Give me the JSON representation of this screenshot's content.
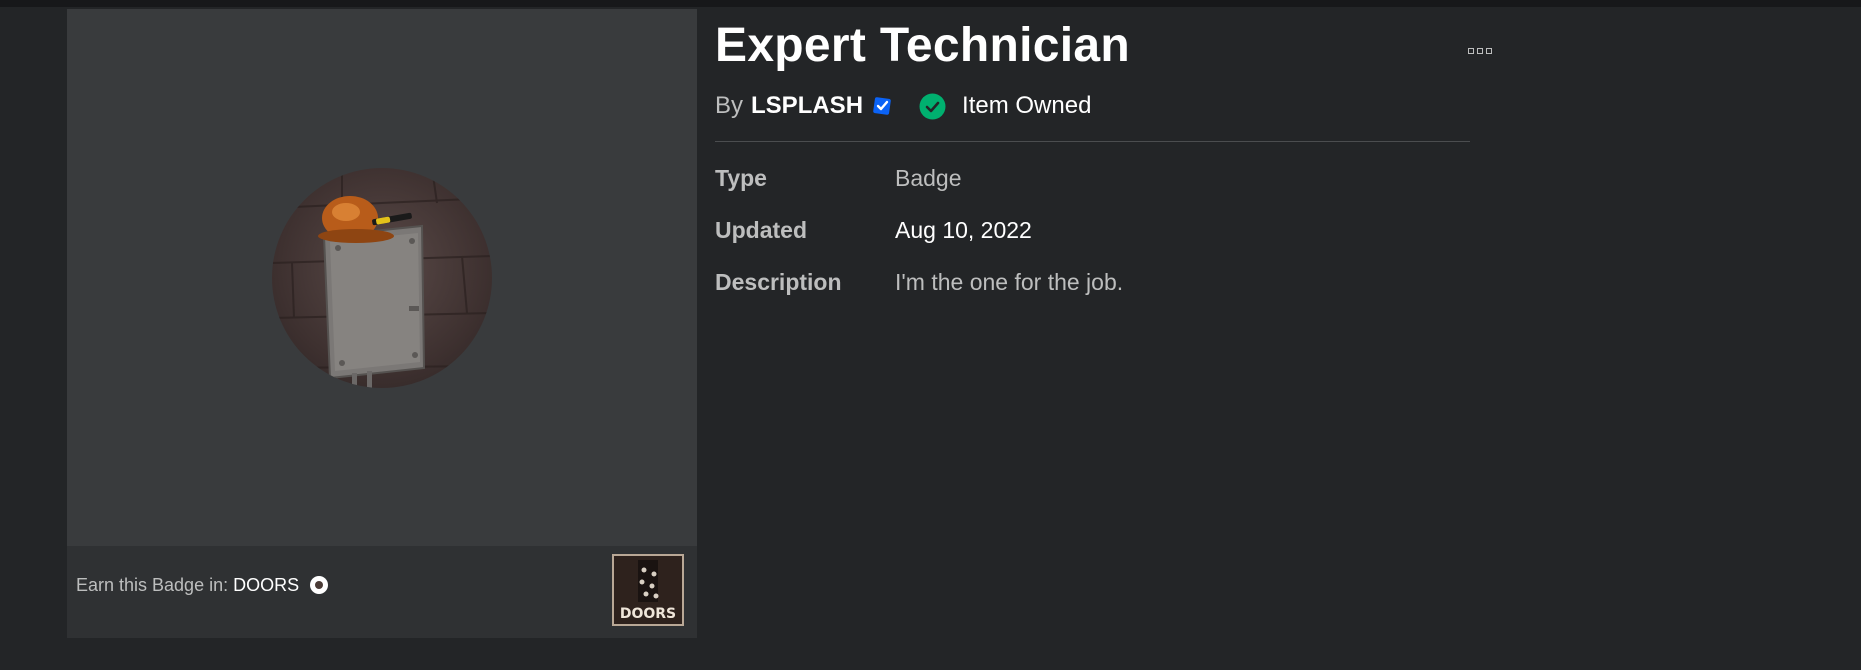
{
  "item": {
    "title": "Expert Technician",
    "by_label": "By",
    "creator": "LSPLASH",
    "owned_label": "Item Owned"
  },
  "details": {
    "type_label": "Type",
    "type_value": "Badge",
    "updated_label": "Updated",
    "updated_value": "Aug 10, 2022",
    "description_label": "Description",
    "description_value": "I'm the one for the job."
  },
  "earn": {
    "prefix": "Earn this Badge in:",
    "game_name": "DOORS",
    "game_thumb_text": "DOORS"
  },
  "icons": {
    "more": "more-options-icon",
    "verified": "verified-badge-icon",
    "owned": "checkmark-circle-icon",
    "game_owned": "game-indicator-icon"
  },
  "colors": {
    "background": "#232527",
    "panel": "#393b3d",
    "verified_blue": "#0b63f6",
    "owned_green": "#00b06f",
    "text_primary": "#ffffff",
    "text_secondary": "#bdbebe"
  }
}
